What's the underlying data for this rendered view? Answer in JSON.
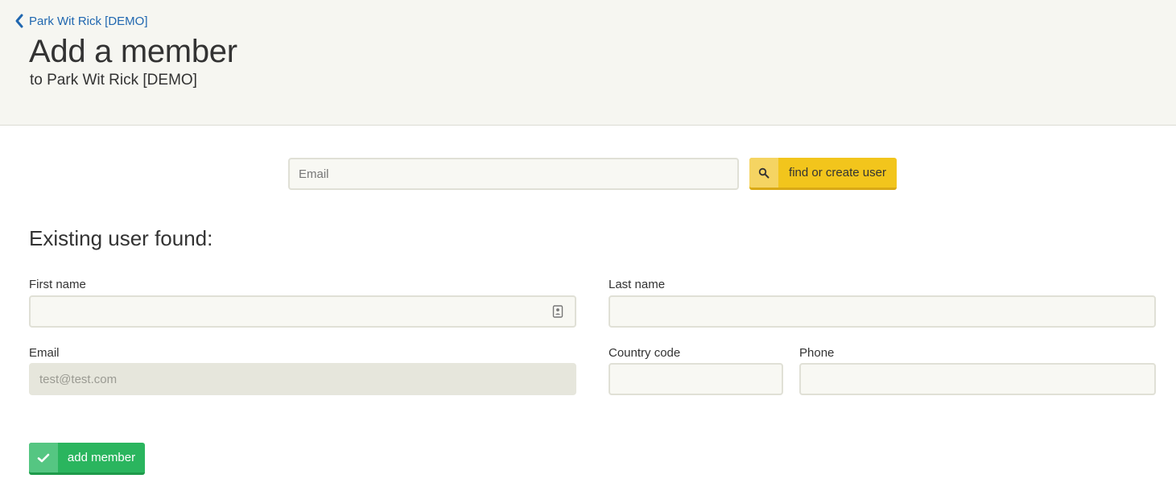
{
  "header": {
    "back_link": "Park Wit Rick [DEMO]",
    "title": "Add a member",
    "subtitle": "to Park Wit Rick [DEMO]"
  },
  "search": {
    "placeholder": "Email",
    "button_label": "find or create user",
    "button_icon": "search-icon"
  },
  "result": {
    "heading": "Existing user found:",
    "fields": {
      "first_name": {
        "label": "First name",
        "value": ""
      },
      "last_name": {
        "label": "Last name",
        "value": ""
      },
      "email": {
        "label": "Email",
        "value": "test@test.com"
      },
      "country_code": {
        "label": "Country code",
        "value": ""
      },
      "phone": {
        "label": "Phone",
        "value": ""
      }
    }
  },
  "actions": {
    "add_member_label": "add member",
    "add_member_icon": "checkmark-icon"
  },
  "colors": {
    "link": "#2067b0",
    "header_bg": "#f6f6f1",
    "search_button": "#f2c51c",
    "add_button": "#2ab55e"
  }
}
